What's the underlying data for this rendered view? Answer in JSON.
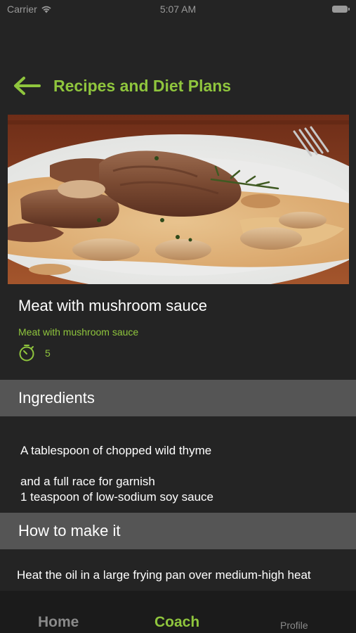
{
  "status_bar": {
    "carrier": "Carrier",
    "time": "5:07 AM"
  },
  "header": {
    "title": "Recipes and Diet Plans"
  },
  "recipe": {
    "title": "Meat with mushroom sauce",
    "subtitle": "Meat with mushroom sauce",
    "time": "5"
  },
  "sections": {
    "ingredients_title": "Ingredients",
    "ingredients": [
      "A tablespoon of chopped wild thyme",
      "and a full race for garnish",
      "1 teaspoon of low-sodium soy sauce"
    ],
    "howto_title": "How to make it",
    "howto_text": "Heat the oil in a large frying pan over medium-high heat"
  },
  "tabs": [
    {
      "label": "Home"
    },
    {
      "label": "Coach"
    },
    {
      "label": "Profile"
    }
  ],
  "colors": {
    "accent": "#8fc53d",
    "background": "#242424",
    "section_header": "#555555",
    "tab_bar": "#1b1b1b"
  }
}
